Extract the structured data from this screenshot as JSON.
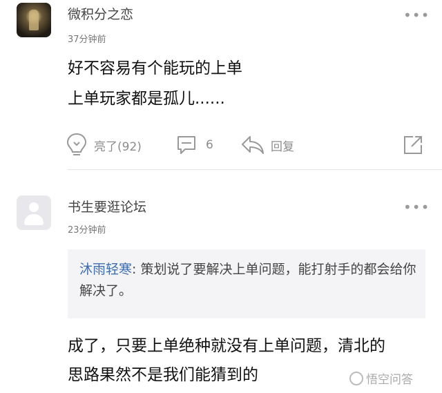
{
  "comments": [
    {
      "username": "微积分之恋",
      "time": "37分钟前",
      "lines": [
        "好不容易有个能玩的上单",
        "上单玩家都是孤儿......"
      ],
      "like_label": "亮了(92)",
      "comment_count": "6",
      "reply_label": "回复",
      "more_label": "•••"
    },
    {
      "username": "书生要逛论坛",
      "time": "23分钟前",
      "quote_name": "沐雨轻寒",
      "quote_text": ": 策划说了要解决上单问题，能打射手的都会给你解决了。",
      "lines": [
        "成了，只要上单绝种就没有上单问题，清北的",
        "思路果然不是我们能猜到的"
      ],
      "more_label": "•••"
    }
  ],
  "watermark": "悟空问答",
  "colors": {
    "quote_name": "#3d6cb0",
    "quote_bg": "#f4f4f6"
  }
}
